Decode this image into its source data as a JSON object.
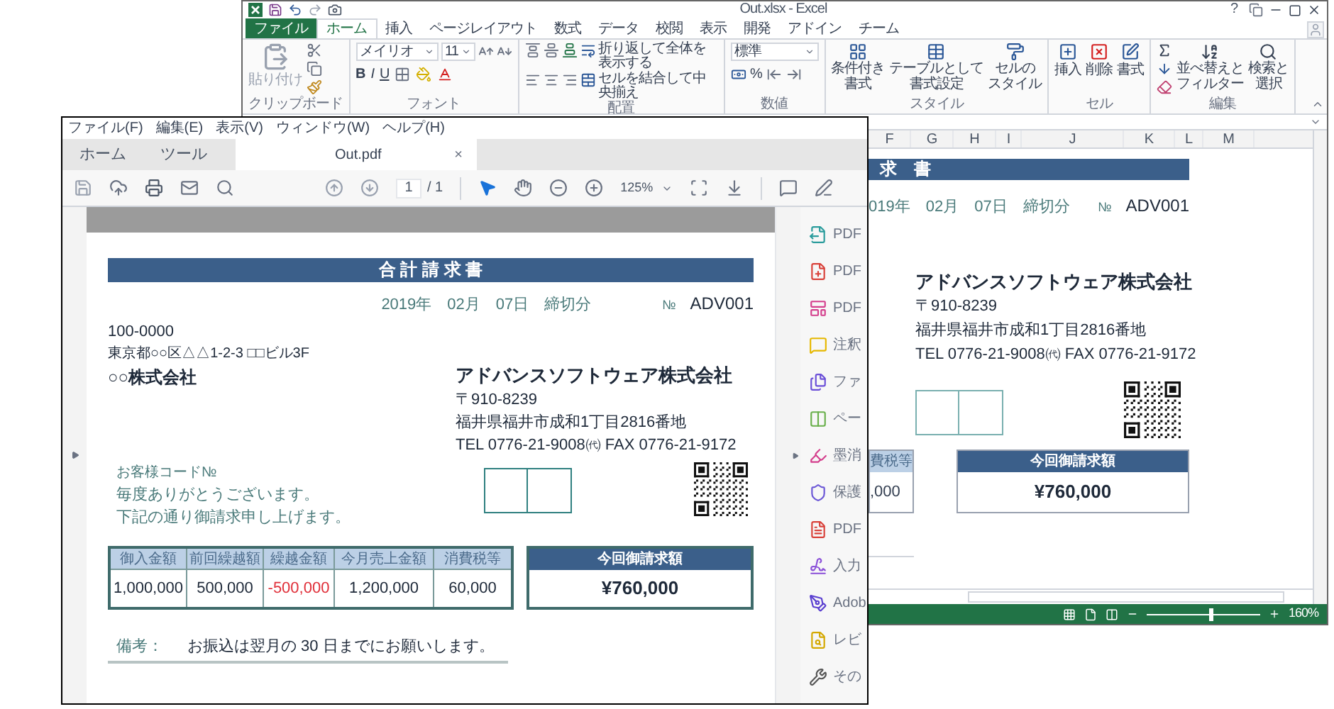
{
  "excel": {
    "title": "Out.xlsx - Excel",
    "help": "?",
    "tabs": [
      {
        "label": "ファイル",
        "selected": false,
        "kind": "file"
      },
      {
        "label": "ホーム",
        "selected": true,
        "kind": "tab"
      },
      {
        "label": "挿入",
        "selected": false,
        "kind": "tab"
      },
      {
        "label": "ページレイアウト",
        "selected": false,
        "kind": "tab"
      },
      {
        "label": "数式",
        "selected": false,
        "kind": "tab"
      },
      {
        "label": "データ",
        "selected": false,
        "kind": "tab"
      },
      {
        "label": "校閲",
        "selected": false,
        "kind": "tab"
      },
      {
        "label": "表示",
        "selected": false,
        "kind": "tab"
      },
      {
        "label": "開発",
        "selected": false,
        "kind": "tab"
      },
      {
        "label": "アドイン",
        "selected": false,
        "kind": "tab"
      },
      {
        "label": "チーム",
        "selected": false,
        "kind": "tab"
      }
    ],
    "ribbon": {
      "clipboard": {
        "label": "クリップボード",
        "paste": "貼り付け"
      },
      "font": {
        "label": "フォント",
        "family": "メイリオ",
        "size": "11",
        "styles": [
          "B",
          "I",
          "U"
        ]
      },
      "alignment": {
        "label": "配置",
        "wrap": "折り返して全体を表示する",
        "merge": "セルを結合して中央揃え"
      },
      "number": {
        "label": "数値",
        "format": "標準",
        "percent": "%"
      },
      "styles": {
        "label": "スタイル",
        "buttons": [
          [
            "条件付き",
            "書式"
          ],
          [
            "テーブルとして",
            "書式設定"
          ],
          [
            "セルの",
            "スタイル"
          ]
        ]
      },
      "cells": {
        "label": "セル",
        "buttons": [
          "挿入",
          "削除",
          "書式"
        ]
      },
      "editing": {
        "label": "編集",
        "buttons": [
          [
            "並べ替えと",
            "フィルター"
          ],
          [
            "検索と",
            "選択"
          ]
        ]
      }
    },
    "columns": [
      "F",
      "G",
      "H",
      "I",
      "J",
      "K",
      "L",
      "M"
    ],
    "sheet": {
      "title": "求　書",
      "date": "019年　02月　07日　締切分",
      "no_label": "№",
      "no": "ADV001",
      "company": "アドバンスソフトウェア株式会社",
      "postal": "〒910-8239",
      "address": "福井県福井市成和1丁目2816番地",
      "tel": "TEL 0776-21-9008㈹ FAX 0776-21-9172",
      "table_header": "費税等",
      "table_value": ",000",
      "total_label": "今回御請求額",
      "total_value": "¥760,000"
    },
    "zoom": {
      "level": 0.55,
      "reading": "160%"
    }
  },
  "acrobat": {
    "menu": [
      "ファイル(F)",
      "編集(E)",
      "表示(V)",
      "ウィンドウ(W)",
      "ヘルプ(H)"
    ],
    "tabs": [
      {
        "label": "ホーム",
        "selected": false,
        "kind": "nav"
      },
      {
        "label": "ツール",
        "selected": false,
        "kind": "nav"
      },
      {
        "label": "Out.pdf",
        "selected": true,
        "kind": "document",
        "close": "×"
      }
    ],
    "page": "1",
    "page_total": "/ 1",
    "zoom": "125%",
    "document": {
      "title": "合 計 請 求 書",
      "date": "2019年　02月　07日　締切分",
      "no_label": "№",
      "no": "ADV001",
      "recipient": {
        "postal": "100-0000",
        "address": "東京都○○区△△1-2-3 □□ビル3F",
        "name": "○○株式会社"
      },
      "sender": {
        "name": "アドバンスソフトウェア株式会社",
        "postal": "〒910-8239",
        "address": "福井県福井市成和1丁目2816番地",
        "tel": "TEL 0776-21-9008㈹ FAX 0776-21-9172"
      },
      "customer_code_label": "お客様コード№",
      "greeting": [
        "毎度ありがとうございます。",
        "下記の通り御請求申し上げます。"
      ],
      "table": [
        {
          "header": "御入金額",
          "value": "1,000,000",
          "negative": false
        },
        {
          "header": "前回繰越額",
          "value": "500,000",
          "negative": false
        },
        {
          "header": "繰越金額",
          "value": "-500,000",
          "negative": true
        },
        {
          "header": "今月売上金額",
          "value": "1,200,000",
          "negative": false
        },
        {
          "header": "消費税等",
          "value": "60,000",
          "negative": false
        }
      ],
      "total": {
        "label": "今回御請求額",
        "value": "¥760,000"
      },
      "remark_label": "備考：",
      "remark": "お振込は翌月の 30 日までにお願いします。"
    },
    "tools": [
      "PDF",
      "PDF",
      "PDF",
      "注釈",
      "ファ",
      "ペー",
      "墨消",
      "保護",
      "PDF",
      "入力",
      "Adob",
      "レビ",
      "その"
    ]
  }
}
